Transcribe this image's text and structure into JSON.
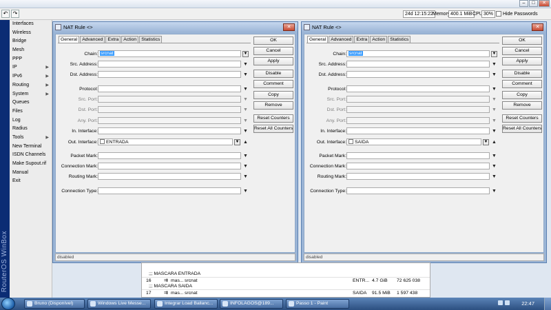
{
  "toolbar": {
    "uptime": "24d 12:15:22",
    "memory_label": "Memory:",
    "memory_value": "400.1 MiB",
    "cpu_label": "CPU:",
    "cpu_value": "30%",
    "hide_passwords_label": "Hide Passwords",
    "undo_icon": "undo-icon",
    "redo_icon": "redo-icon"
  },
  "brand": {
    "text": "RouterOS WinBox"
  },
  "sidebar": {
    "items": [
      {
        "label": "Interfaces",
        "submenu": false
      },
      {
        "label": "Wireless",
        "submenu": false
      },
      {
        "label": "Bridge",
        "submenu": false
      },
      {
        "label": "Mesh",
        "submenu": false
      },
      {
        "label": "PPP",
        "submenu": false
      },
      {
        "label": "IP",
        "submenu": true
      },
      {
        "label": "IPv6",
        "submenu": true
      },
      {
        "label": "Routing",
        "submenu": true
      },
      {
        "label": "System",
        "submenu": true
      },
      {
        "label": "Queues",
        "submenu": false
      },
      {
        "label": "Files",
        "submenu": false
      },
      {
        "label": "Log",
        "submenu": false
      },
      {
        "label": "Radius",
        "submenu": false
      },
      {
        "label": "Tools",
        "submenu": true
      },
      {
        "label": "New Terminal",
        "submenu": false
      },
      {
        "label": "ISDN Channels",
        "submenu": false
      },
      {
        "label": "Make Supout.rif",
        "submenu": false
      },
      {
        "label": "Manual",
        "submenu": false
      },
      {
        "label": "Exit",
        "submenu": false
      }
    ]
  },
  "dialog_common": {
    "title": "NAT Rule <>",
    "tabs": [
      "General",
      "Advanced",
      "Extra",
      "Action",
      "Statistics"
    ],
    "labels": {
      "chain": "Chain:",
      "src_address": "Src. Address:",
      "dst_address": "Dst. Address:",
      "protocol": "Protocol:",
      "src_port": "Src. Port:",
      "dst_port": "Dst. Port:",
      "any_port": "Any. Port:",
      "in_interface": "In. Interface:",
      "out_interface": "Out. Interface:",
      "packet_mark": "Packet Mark:",
      "connection_mark": "Connection Mark:",
      "routing_mark": "Routing Mark:",
      "connection_type": "Connection Type:"
    },
    "buttons": {
      "ok": "OK",
      "cancel": "Cancel",
      "apply": "Apply",
      "disable": "Disable",
      "comment": "Comment",
      "copy": "Copy",
      "remove": "Remove",
      "reset_counters": "Reset Counters",
      "reset_all_counters": "Reset All Counters"
    },
    "status": "disabled"
  },
  "dialog1": {
    "chain": "srcnat",
    "out_interface": "ENTRADA"
  },
  "dialog2": {
    "chain": "srcnat",
    "out_interface": "SAIDA"
  },
  "bg_table": {
    "rows": [
      {
        "kind": "header",
        "text": ";;; MASCARA ENTRADA"
      },
      {
        "kind": "rule",
        "num": "16",
        "action": "mas...",
        "chain": "srcnat",
        "iface": "ENTR...",
        "bytes": "4.7 GiB",
        "packets": "72 625 038"
      },
      {
        "kind": "header",
        "text": ";;; MASCARA SAIDA"
      },
      {
        "kind": "rule",
        "num": "17",
        "action": "mas...",
        "chain": "srcnat",
        "iface": "SAIDA",
        "bytes": "91.5 MiB",
        "packets": "1 597 438"
      }
    ]
  },
  "taskbar": {
    "tasks": [
      "Bruno (Disponível)",
      "Windows Live Messe...",
      "Integrar Load Ballanc...",
      "INFOLAGOS@189...",
      "Passo 1 - Paint"
    ],
    "clock": "22:47"
  },
  "colors": {
    "brand_strip": "#0b2c74",
    "dialog_frame": "#9bb5d6",
    "taskbar": "#2c4f80"
  }
}
